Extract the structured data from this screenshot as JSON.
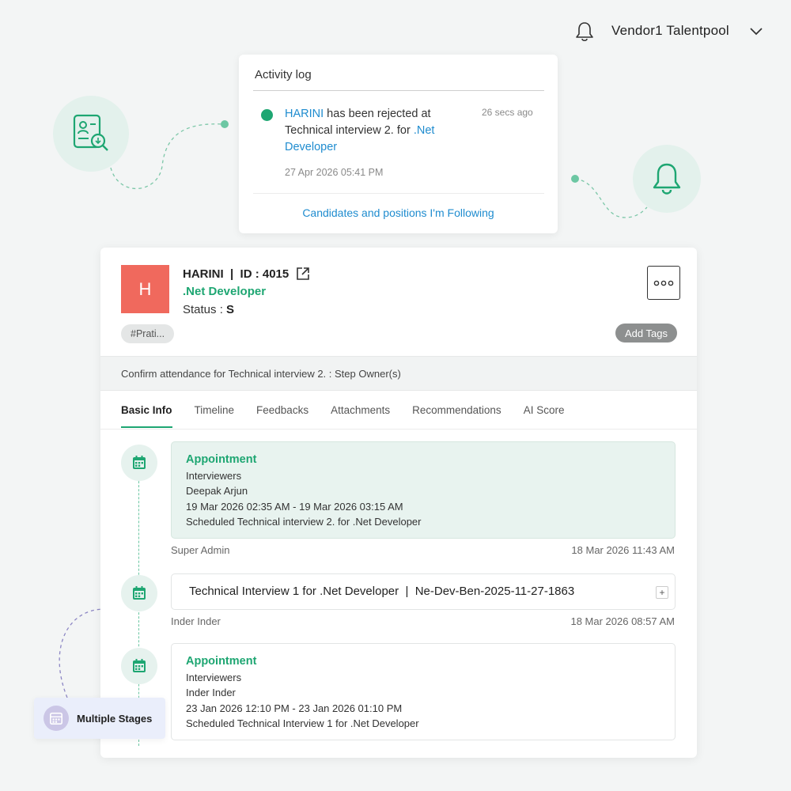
{
  "topbar": {
    "user_name": "Vendor1 Talentpool",
    "bell_icon": "bell-icon",
    "dropdown_icon": "chevron-down-icon"
  },
  "activity_log": {
    "title": "Activity log",
    "candidate": "HARINI",
    "text_1": " has been rejected at",
    "text_2": "Technical interview 2.",
    "text_3": " for ",
    "position": ".Net Developer",
    "time_ago": "26 secs ago",
    "datetime": "27 Apr 2026 05:41 PM",
    "follow_link": "Candidates and positions I'm Following"
  },
  "candidate": {
    "avatar_letter": "H",
    "header": "HARINI  |  ID : 4015",
    "position": ".Net Developer",
    "status_label": "Status : ",
    "status_value": "S",
    "tag": "#Prati...",
    "add_tags_label": "Add Tags",
    "step_text": "Confirm attendance for Technical interview 2. : Step Owner(s)"
  },
  "tabs": [
    {
      "label": "Basic Info",
      "active": true
    },
    {
      "label": "Timeline"
    },
    {
      "label": "Feedbacks"
    },
    {
      "label": "Attachments"
    },
    {
      "label": "Recommendations"
    },
    {
      "label": "AI Score"
    }
  ],
  "timeline": [
    {
      "title": "Appointment",
      "line1": "Interviewers",
      "line2": "Deepak Arjun",
      "line3": "19 Mar 2026 02:35 AM - 19 Mar 2026 03:15 AM",
      "line4": "Scheduled Technical interview 2. for .Net Developer",
      "owner": "Super Admin",
      "datetime": "18 Mar 2026 11:43 AM"
    },
    {
      "text": "Technical Interview 1 for .Net Developer  |  Ne-Dev-Ben-2025-11-27-1863",
      "expand": "+",
      "owner": "Inder Inder",
      "datetime": "18 Mar 2026 08:57 AM"
    },
    {
      "title": "Appointment",
      "line1": "Interviewers",
      "line2": "Inder Inder",
      "line3": "23 Jan 2026 12:10 PM - 23 Jan 2026 01:10 PM",
      "line4": "Scheduled Technical Interview 1 for .Net Developer"
    }
  ],
  "badge": {
    "label": "Multiple Stages"
  },
  "colors": {
    "accent": "#1ea672",
    "link": "#1f8ccf",
    "avatar": "#f0695d",
    "highlight_bg": "#e8f3ef"
  }
}
